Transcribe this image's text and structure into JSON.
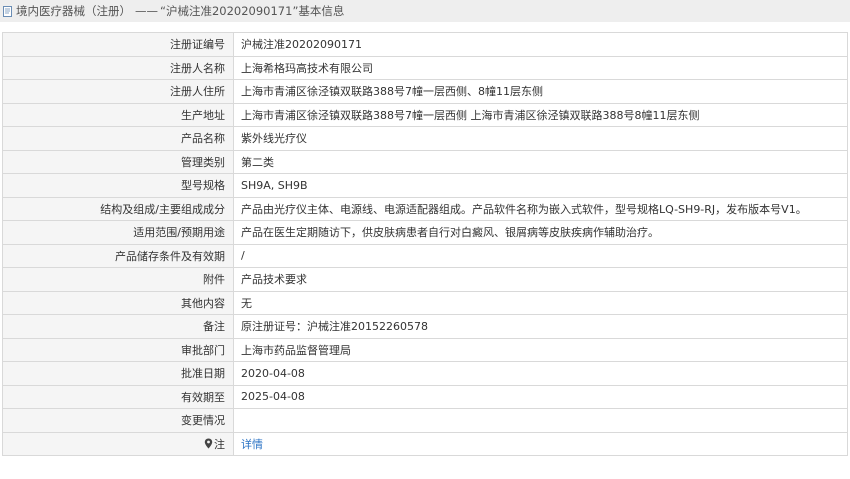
{
  "header": {
    "title": "境内医疗器械（注册）",
    "separator": "——",
    "record_title": "“沪械注准20202090171”基本信息"
  },
  "rows": [
    {
      "label": "注册证编号",
      "value": "沪械注准20202090171"
    },
    {
      "label": "注册人名称",
      "value": "上海希格玛高技术有限公司"
    },
    {
      "label": "注册人住所",
      "value": "上海市青浦区徐泾镇双联路388号7幢一层西侧、8幢11层东侧"
    },
    {
      "label": "生产地址",
      "value": "上海市青浦区徐泾镇双联路388号7幢一层西侧 上海市青浦区徐泾镇双联路388号8幢11层东侧"
    },
    {
      "label": "产品名称",
      "value": "紫外线光疗仪"
    },
    {
      "label": "管理类别",
      "value": "第二类"
    },
    {
      "label": "型号规格",
      "value": "SH9A, SH9B"
    },
    {
      "label": "结构及组成/主要组成成分",
      "value": "产品由光疗仪主体、电源线、电源适配器组成。产品软件名称为嵌入式软件，型号规格LQ-SH9-RJ，发布版本号V1。"
    },
    {
      "label": "适用范围/预期用途",
      "value": "产品在医生定期随访下，供皮肤病患者自行对白癜风、银屑病等皮肤疾病作辅助治疗。"
    },
    {
      "label": "产品储存条件及有效期",
      "value": "/"
    },
    {
      "label": "附件",
      "value": "产品技术要求"
    },
    {
      "label": "其他内容",
      "value": "无"
    },
    {
      "label": "备注",
      "value": "原注册证号：沪械注准20152260578"
    },
    {
      "label": "审批部门",
      "value": "上海市药品监督管理局"
    },
    {
      "label": "批准日期",
      "value": "2020-04-08"
    },
    {
      "label": "有效期至",
      "value": "2025-04-08"
    },
    {
      "label": "变更情况",
      "value": ""
    }
  ],
  "note_row": {
    "icon": "location-pin-icon",
    "label": "注",
    "link": "详情"
  },
  "colors": {
    "label_bg": "#f5f5f5",
    "border": "#d9d9d9",
    "link": "#2a72c4",
    "header_bg": "#eeeeee"
  }
}
